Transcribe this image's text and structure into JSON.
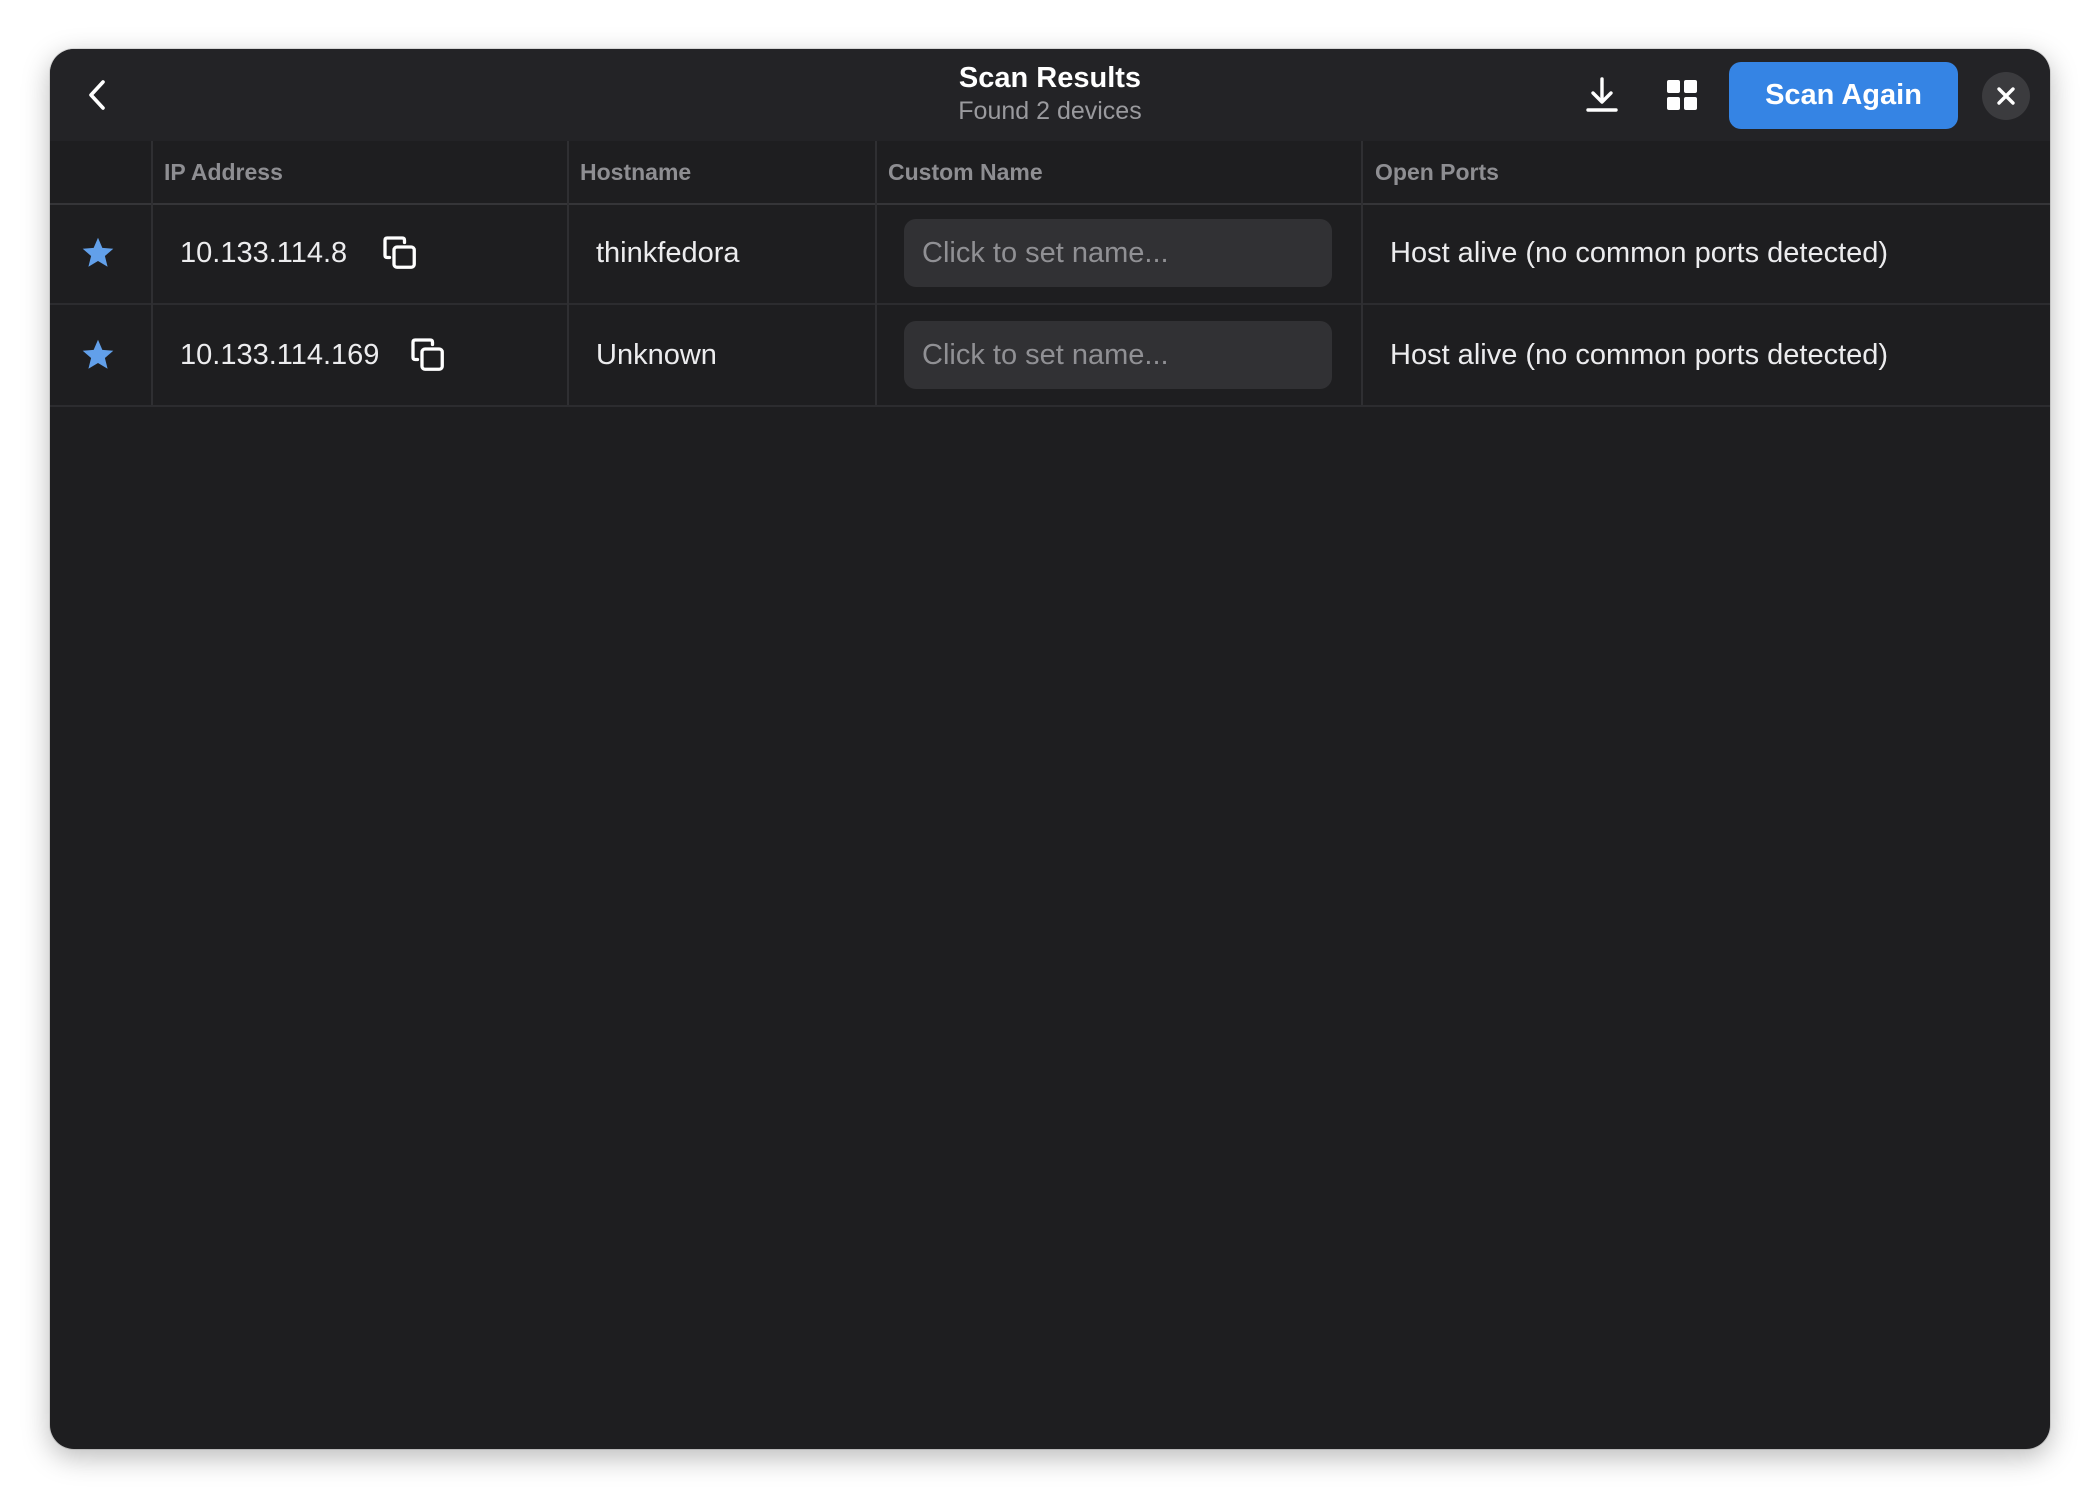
{
  "header": {
    "title": "Scan Results",
    "subtitle": "Found 2 devices",
    "scan_again_label": "Scan Again",
    "icons": {
      "back": "chevron-left-icon",
      "download": "download-icon",
      "view": "grid-view-icon",
      "close": "close-icon"
    },
    "accent_color": "#3584e4"
  },
  "table": {
    "columns": [
      "",
      "IP Address",
      "Hostname",
      "Custom Name",
      "Open Ports"
    ],
    "rows": [
      {
        "favorite": true,
        "ip": "10.133.114.8",
        "hostname": "thinkfedora",
        "custom_name": "",
        "custom_name_placeholder": "Click to set name...",
        "open_ports": "Host alive (no common ports detected)"
      },
      {
        "favorite": true,
        "ip": "10.133.114.169",
        "hostname": "Unknown",
        "custom_name": "",
        "custom_name_placeholder": "Click to set name...",
        "open_ports": "Host alive (no common ports detected)"
      }
    ],
    "star_color": "#62a0ea"
  }
}
